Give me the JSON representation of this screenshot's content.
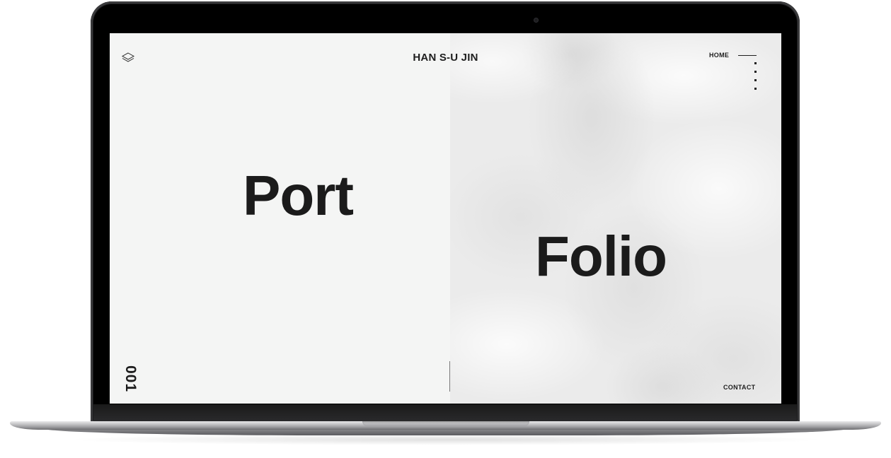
{
  "site": {
    "brand": "HAN S-U JIN",
    "logo_icon": "layers-icon"
  },
  "nav": {
    "home_label": "HOME",
    "menu_icon": "vertical-dots-menu-icon",
    "contact_label": "CONTACT"
  },
  "hero": {
    "word_left": "Port",
    "word_right": "Folio",
    "page_number": "001"
  },
  "colors": {
    "text": "#1b1b1b",
    "left_panel": "#f4f5f4",
    "right_panel": "#ebebeb",
    "device_frame": "#000000"
  }
}
